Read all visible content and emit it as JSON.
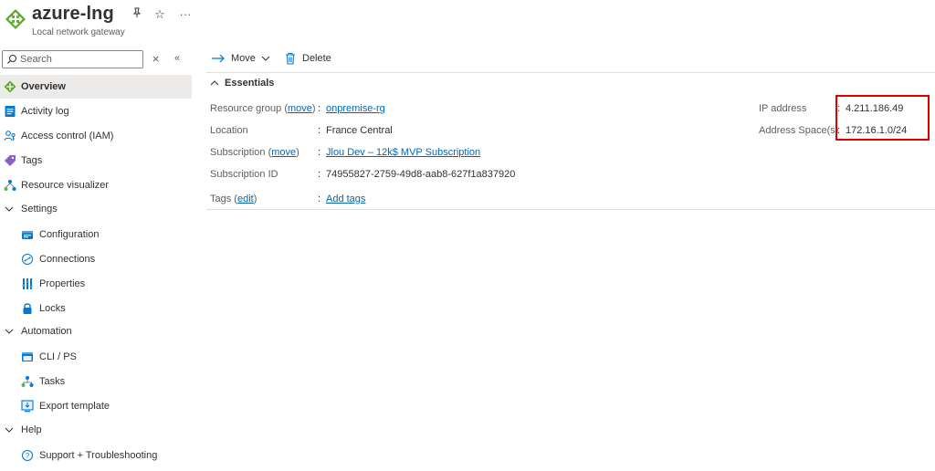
{
  "header": {
    "title": "azure-lng",
    "subtitle": "Local network gateway",
    "pin_icon": "pin-icon",
    "star_icon": "star-icon",
    "more_icon": "more-icon"
  },
  "sidebar": {
    "search_placeholder": "Search",
    "items": [
      {
        "label": "Overview",
        "icon": "local-network-gateway-icon",
        "active": true
      },
      {
        "label": "Activity log",
        "icon": "activity-log-icon"
      },
      {
        "label": "Access control (IAM)",
        "icon": "iam-icon"
      },
      {
        "label": "Tags",
        "icon": "tag-icon"
      },
      {
        "label": "Resource visualizer",
        "icon": "visualizer-icon"
      },
      {
        "label": "Settings",
        "icon": "chevron-down-icon",
        "group": true
      },
      {
        "label": "Configuration",
        "icon": "configuration-icon"
      },
      {
        "label": "Connections",
        "icon": "connections-icon"
      },
      {
        "label": "Properties",
        "icon": "properties-icon"
      },
      {
        "label": "Locks",
        "icon": "lock-icon"
      },
      {
        "label": "Automation",
        "icon": "chevron-down-icon",
        "group": true
      },
      {
        "label": "CLI / PS",
        "icon": "cli-icon"
      },
      {
        "label": "Tasks",
        "icon": "tasks-icon"
      },
      {
        "label": "Export template",
        "icon": "export-template-icon"
      },
      {
        "label": "Help",
        "icon": "chevron-down-icon",
        "group": true
      },
      {
        "label": "Support + Troubleshooting",
        "icon": "support-icon"
      }
    ]
  },
  "toolbar": {
    "move_label": "Move",
    "delete_label": "Delete"
  },
  "essentials": {
    "title": "Essentials",
    "resource_group_label": "Resource group (",
    "resource_group_link": "move",
    "resource_group_close": ")",
    "resource_group_value": "onpremise-rg",
    "location_label": "Location",
    "location_value": "France Central",
    "subscription_label": "Subscription (",
    "subscription_link": "move",
    "subscription_close": ")",
    "subscription_value": "Jlou Dev – 12k$ MVP Subscription",
    "subscription_id_label": "Subscription ID",
    "subscription_id_value": "74955827-2759-49d8-aab8-627f1a837920",
    "tags_label": "Tags (",
    "tags_link": "edit",
    "tags_close": ")",
    "tags_value": "Add tags",
    "ip_address_label": "IP address",
    "ip_address_value": "4.211.186.49",
    "address_space_label": "Address Space(s)",
    "address_space_value": "172.16.1.0/24",
    "colon": ":"
  },
  "colors": {
    "accent": "#0078d4",
    "link": "#0067b8",
    "highlight": "#e00000",
    "gateway_green": "#5ea92f"
  }
}
